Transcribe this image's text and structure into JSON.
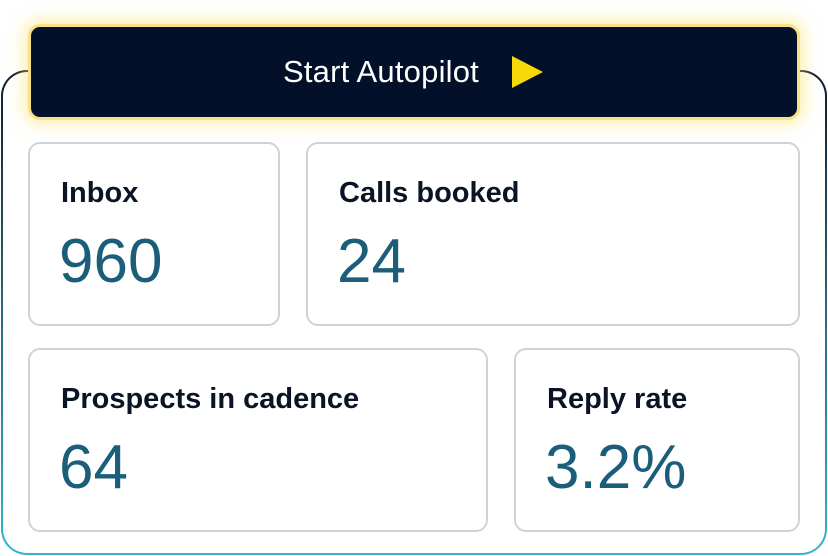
{
  "autopilot": {
    "label": "Start Autopilot",
    "icon": "play-icon",
    "icon_color": "#f5d90a"
  },
  "stats": {
    "inbox": {
      "label": "Inbox",
      "value": "960"
    },
    "calls_booked": {
      "label": "Calls booked",
      "value": "24"
    },
    "prospects": {
      "label": "Prospects in cadence",
      "value": "64"
    },
    "reply_rate": {
      "label": "Reply rate",
      "value": "3.2%"
    }
  },
  "colors": {
    "button_bg": "#02102a",
    "value_text": "#1a5e7a",
    "label_text": "#0b1424"
  }
}
